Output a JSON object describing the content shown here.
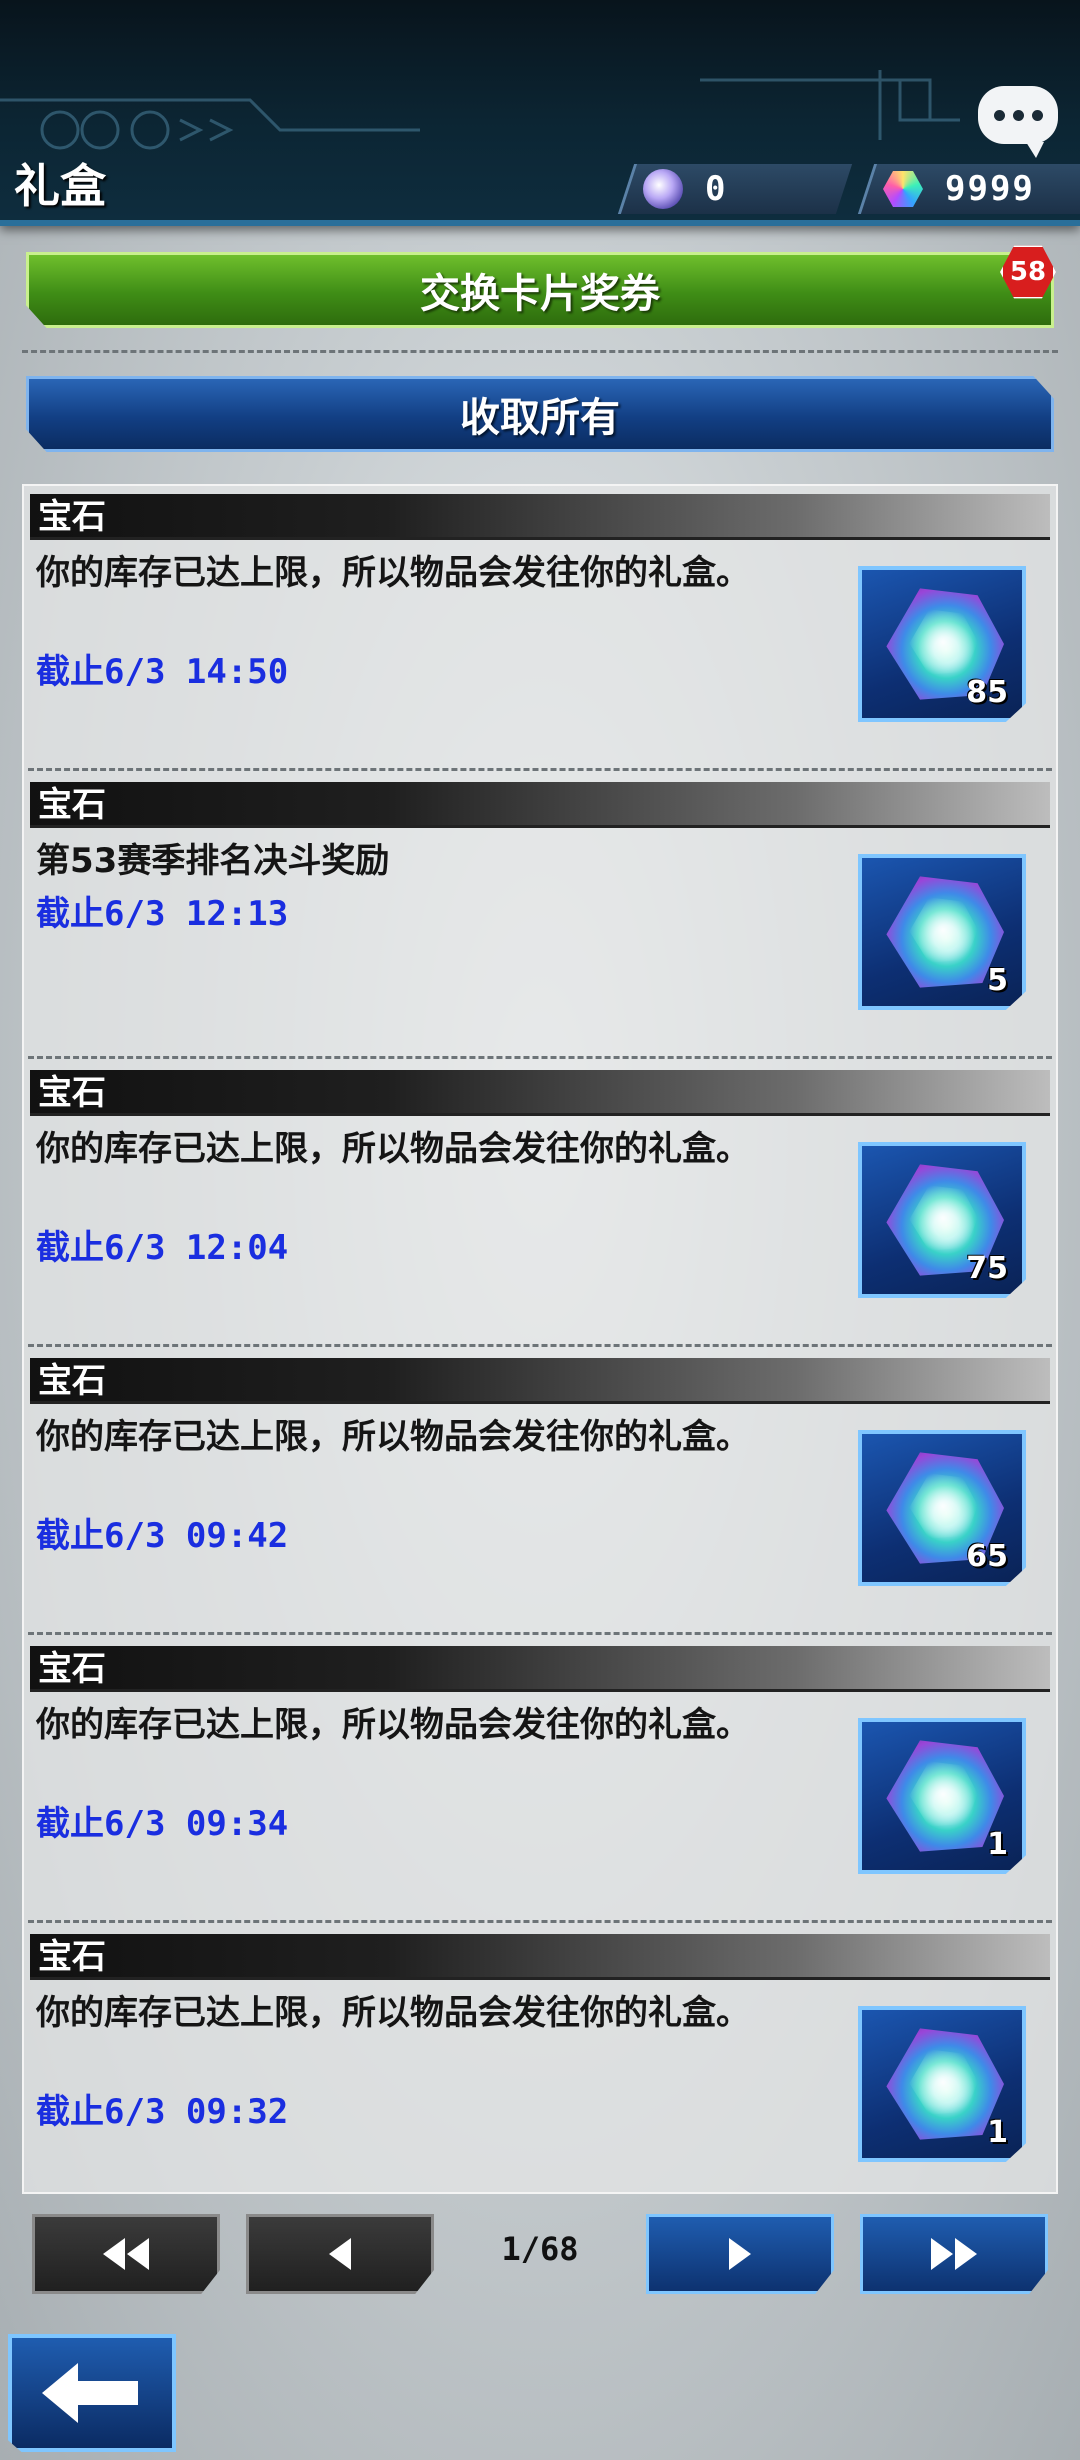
{
  "header": {
    "title": "礼盒",
    "orb_currency": "0",
    "gem_currency": "9999"
  },
  "actions": {
    "exchange_label": "交换卡片奖券",
    "exchange_badge": "58",
    "collect_all_label": "收取所有"
  },
  "items": [
    {
      "category": "宝石",
      "message": "你的库存已达上限，所以物品会发往你的礼盒。",
      "deadline_prefix": "截止",
      "deadline": "6/3 14:50",
      "quantity": "85"
    },
    {
      "category": "宝石",
      "message": "第53赛季排名决斗奖励",
      "deadline_prefix": "截止",
      "deadline": "6/3 12:13",
      "quantity": "5"
    },
    {
      "category": "宝石",
      "message": "你的库存已达上限，所以物品会发往你的礼盒。",
      "deadline_prefix": "截止",
      "deadline": "6/3 12:04",
      "quantity": "75"
    },
    {
      "category": "宝石",
      "message": "你的库存已达上限，所以物品会发往你的礼盒。",
      "deadline_prefix": "截止",
      "deadline": "6/3 09:42",
      "quantity": "65"
    },
    {
      "category": "宝石",
      "message": "你的库存已达上限，所以物品会发往你的礼盒。",
      "deadline_prefix": "截止",
      "deadline": "6/3 09:34",
      "quantity": "1"
    },
    {
      "category": "宝石",
      "message": "你的库存已达上限，所以物品会发往你的礼盒。",
      "deadline_prefix": "截止",
      "deadline": "6/3 09:32",
      "quantity": "1"
    }
  ],
  "pagination": {
    "indicator": "1/68"
  },
  "icons": {
    "chat": "chat-bubble-icon",
    "orb": "orb-currency-icon",
    "gem": "gem-currency-icon",
    "reward": "gem-reward-icon",
    "first": "double-chevron-left-icon",
    "prev": "chevron-left-icon",
    "next": "chevron-right-icon",
    "last": "double-chevron-right-icon",
    "back": "arrow-left-icon"
  },
  "colors": {
    "deadline": "#1a2ee0",
    "exchange_button": "#3f8d16",
    "collect_button": "#123f84",
    "badge": "#d81e1e"
  }
}
